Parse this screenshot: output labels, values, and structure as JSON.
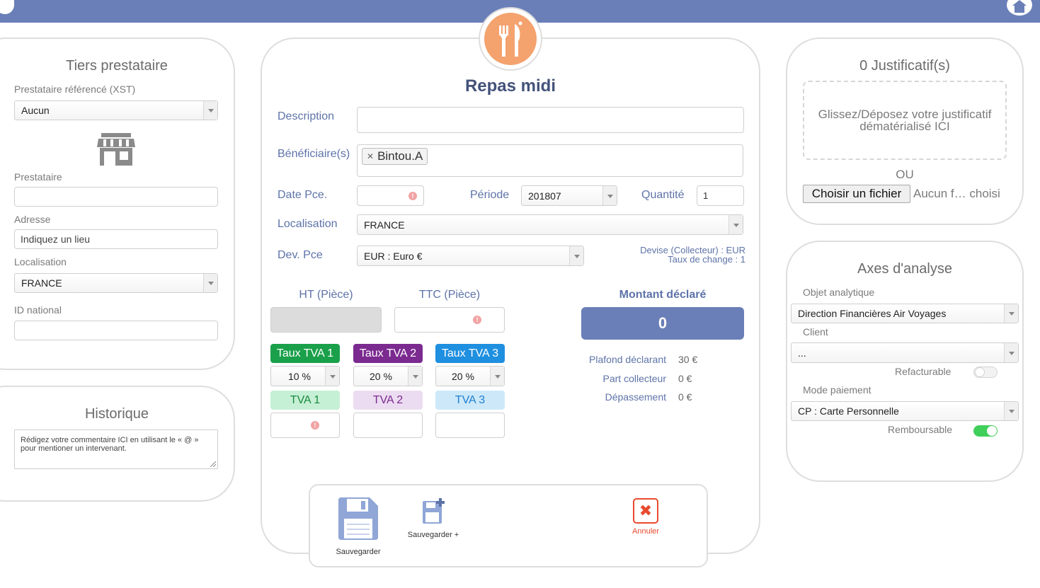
{
  "tiers": {
    "title": "Tiers prestataire",
    "prestataire_ref_label": "Prestataire référencé (XST)",
    "prestataire_ref_value": "Aucun",
    "prestataire_label": "Prestataire",
    "prestataire_value": "",
    "adresse_label": "Adresse",
    "adresse_value": "Indiquez un lieu",
    "localisation_label": "Localisation",
    "localisation_value": "FRANCE",
    "id_national_label": "ID national",
    "id_national_value": ""
  },
  "historique": {
    "title": "Historique",
    "comment_placeholder": "Rédigez votre commentaire ICI en utilisant le « @ » pour mentioner un intervenant."
  },
  "form": {
    "title": "Repas midi",
    "icon": "cutlery-icon",
    "accent_color": "#f4a26e",
    "description_label": "Description",
    "description_value": "",
    "beneficiaires_label": "Bénéficiaire(s)",
    "beneficiaire_tag": "Bintou.A",
    "date_label": "Date Pce.",
    "date_value": "",
    "periode_label": "Période",
    "periode_value": "201807",
    "quantite_label": "Quantité",
    "quantite_value": "1",
    "localisation_label": "Localisation",
    "localisation_value": "FRANCE",
    "devise_label": "Dev. Pce",
    "devise_value": "EUR : Euro €",
    "devise_collecteur": "Devise (Collecteur) : EUR",
    "taux_change": "Taux de change : 1",
    "ht_label": "HT (Pièce)",
    "ttc_label": "TTC (Pièce)",
    "montant_label": "Montant déclaré",
    "montant_value": "0",
    "montant_color": "#6a7fb8",
    "tva": [
      {
        "tag": "Taux TVA 1",
        "rate": "10 %",
        "label": "TVA 1",
        "color": "#1aa04a",
        "light": "#c6f0d5",
        "text": "#1a8a40"
      },
      {
        "tag": "Taux TVA 2",
        "rate": "20 %",
        "label": "TVA 2",
        "color": "#7b2a90",
        "light": "#ecdcf1",
        "text": "#7b2a90"
      },
      {
        "tag": "Taux TVA 3",
        "rate": "20 %",
        "label": "TVA 3",
        "color": "#1f8fe0",
        "light": "#cde9f9",
        "text": "#1f7fcf"
      }
    ],
    "plafond_label": "Plafond déclarant",
    "plafond_value": "30 €",
    "part_label": "Part collecteur",
    "part_value": "0 €",
    "depassement_label": "Dépassement",
    "depassement_value": "0 €"
  },
  "actions": {
    "save": "Sauvegarder",
    "save_plus": "Sauvegarder +",
    "cancel": "Annuler"
  },
  "justificatif": {
    "title": "0 Justificatif(s)",
    "drop_text": "Glissez/Déposez votre justificatif dématérialisé ICI",
    "ou": "OU",
    "file_button": "Choisir un fichier",
    "file_status": "Aucun f… choisi"
  },
  "axes": {
    "title": "Axes d'analyse",
    "objet_label": "Objet analytique",
    "objet_value": "Direction Financières Air Voyages",
    "client_label": "Client",
    "client_value": "...",
    "refacturable_label": "Refacturable",
    "mode_label": "Mode paiement",
    "mode_value": "CP : Carte Personnelle",
    "remboursable_label": "Remboursable",
    "toggle_on_color": "#3fcf5a"
  }
}
